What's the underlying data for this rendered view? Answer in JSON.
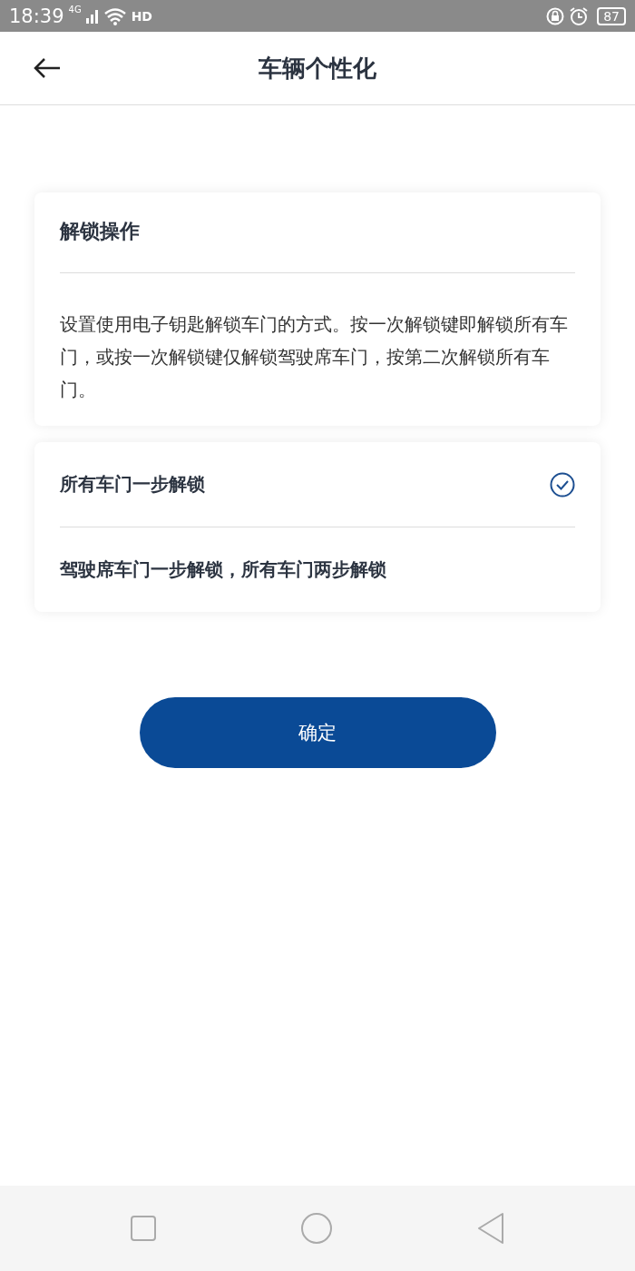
{
  "status_bar": {
    "time": "18:39",
    "network": "4G",
    "hd": "HD",
    "battery": "87"
  },
  "header": {
    "title": "车辆个性化"
  },
  "info_card": {
    "title": "解锁操作",
    "description": "设置使用电子钥匙解锁车门的方式。按一次解锁键即解锁所有车门，或按一次解锁键仅解锁驾驶席车门，按第二次解锁所有车门。"
  },
  "options": [
    {
      "label": "所有车门一步解锁",
      "selected": true
    },
    {
      "label": "驾驶席车门一步解锁，所有车门两步解锁",
      "selected": false
    }
  ],
  "confirm_button": "确定"
}
